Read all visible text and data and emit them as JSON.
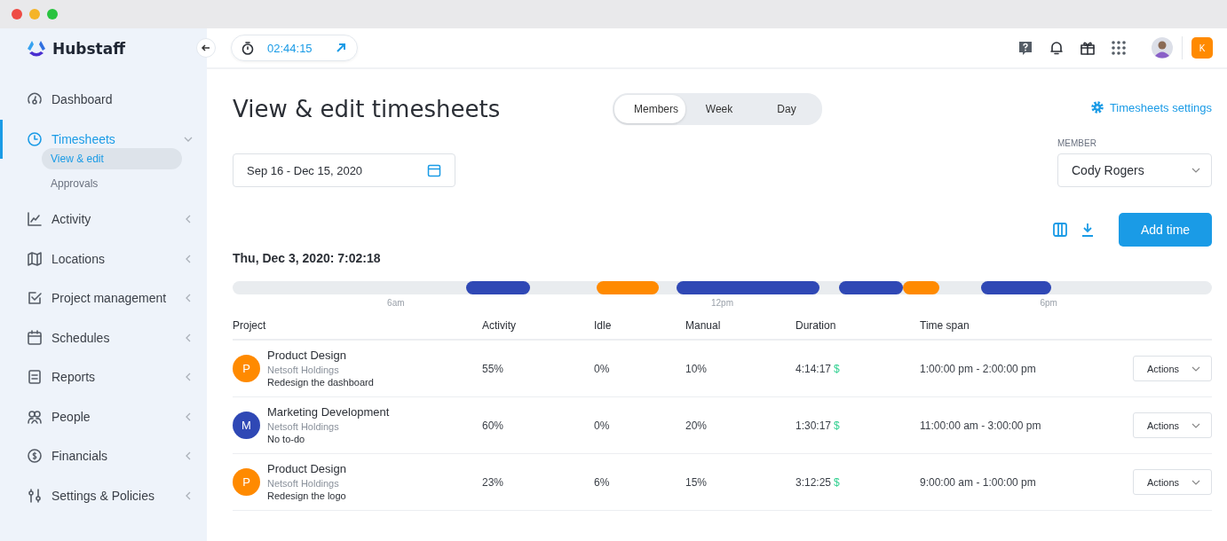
{
  "brand": "Hubstaff",
  "timer": {
    "time": "02:44:15"
  },
  "sidebar": {
    "items": [
      {
        "label": "Dashboard",
        "kind": "link",
        "selected": false
      },
      {
        "label": "Timesheets",
        "kind": "group",
        "selected": true,
        "expanded": true,
        "children": [
          {
            "label": "View & edit",
            "selected": true
          },
          {
            "label": "Approvals",
            "selected": false
          }
        ]
      },
      {
        "label": "Activity",
        "kind": "group",
        "selected": false,
        "expanded": false
      },
      {
        "label": "Locations",
        "kind": "group",
        "selected": false,
        "expanded": false
      },
      {
        "label": "Project management",
        "kind": "group",
        "selected": false,
        "expanded": false
      },
      {
        "label": "Schedules",
        "kind": "group",
        "selected": false,
        "expanded": false
      },
      {
        "label": "Reports",
        "kind": "group",
        "selected": false,
        "expanded": false
      },
      {
        "label": "People",
        "kind": "group",
        "selected": false,
        "expanded": false
      },
      {
        "label": "Financials",
        "kind": "group",
        "selected": false,
        "expanded": false
      },
      {
        "label": "Settings & Policies",
        "kind": "group",
        "selected": false,
        "expanded": false
      }
    ]
  },
  "topbar": {
    "org_badge": "K"
  },
  "page": {
    "title": "View & edit timesheets",
    "tabs": [
      {
        "label": "Members",
        "selected": true
      },
      {
        "label": "Week",
        "selected": false
      },
      {
        "label": "Day",
        "selected": false
      }
    ],
    "settings_link": "Timesheets settings",
    "date_range": "Sep 16 - Dec 15, 2020",
    "member": {
      "label": "MEMBER",
      "value": "Cody Rogers"
    },
    "add_button": "Add time",
    "day_heading": "Thu, Dec 3, 2020:  7:02:18",
    "timeline": {
      "segments": [
        {
          "color": "#2f48b5"
        },
        {
          "color": "#ff8a00"
        },
        {
          "color": "#2f48b5"
        },
        {
          "color": "#2f48b5"
        },
        {
          "color": "#ff8a00"
        },
        {
          "color": "#2f48b5"
        }
      ],
      "ticks": [
        "6am",
        "12pm",
        "6pm"
      ]
    },
    "table": {
      "columns": [
        "Project",
        "Activity",
        "Idle",
        "Manual",
        "Duration",
        "Time span"
      ],
      "rows": [
        {
          "initial": "P",
          "color": "#ff8a00",
          "project": "Product Design",
          "client": "Netsoft Holdings",
          "task": "Redesign the dashboard",
          "activity": "55%",
          "idle": "0%",
          "manual": "10%",
          "duration": "4:14:17",
          "currency": "$",
          "span": "1:00:00 pm - 2:00:00 pm",
          "action": "Actions"
        },
        {
          "initial": "M",
          "color": "#2f48b5",
          "project": "Marketing Development",
          "client": "Netsoft Holdings",
          "task": "No to-do",
          "activity": "60%",
          "idle": "0%",
          "manual": "20%",
          "duration": "1:30:17",
          "currency": "$",
          "span": "11:00:00 am - 3:00:00 pm",
          "action": "Actions"
        },
        {
          "initial": "P",
          "color": "#ff8a00",
          "project": "Product Design",
          "client": "Netsoft Holdings",
          "task": "Redesign the logo",
          "activity": "23%",
          "idle": "6%",
          "manual": "15%",
          "duration": "3:12:25",
          "currency": "$",
          "span": "9:00:00 am - 1:00:00 pm",
          "action": "Actions"
        }
      ]
    }
  }
}
